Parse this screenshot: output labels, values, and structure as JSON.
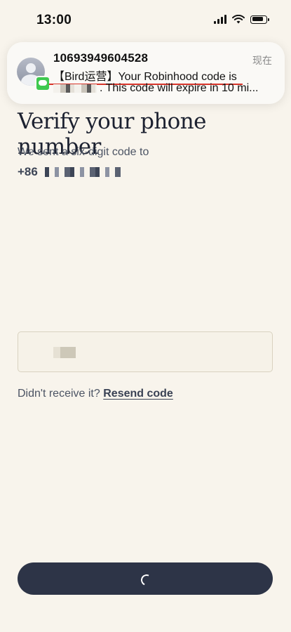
{
  "status_bar": {
    "time": "13:00",
    "icons": [
      "cellular-signal-icon",
      "wifi-icon",
      "battery-icon"
    ]
  },
  "notification": {
    "app_icon": "messages-icon",
    "sender": "10693949604528",
    "time": "现在",
    "line1_prefix": "【Bird运营】",
    "line1_highlight": "Your Robinhood code is",
    "line2": ". This code will expire in 10 mi...",
    "highlight_color": "#d7342a"
  },
  "main": {
    "title": "Verify your phone number",
    "subtitle": "We sent a six-digit code to",
    "country_code": "+86",
    "code_input": {
      "value": "",
      "placeholder": ""
    },
    "resend_prefix": "Didn't receive it?",
    "resend_link": "Resend code",
    "submit_state": "loading"
  },
  "colors": {
    "background": "#f8f4ec",
    "button": "#2d3447",
    "title": "#1c2130"
  }
}
